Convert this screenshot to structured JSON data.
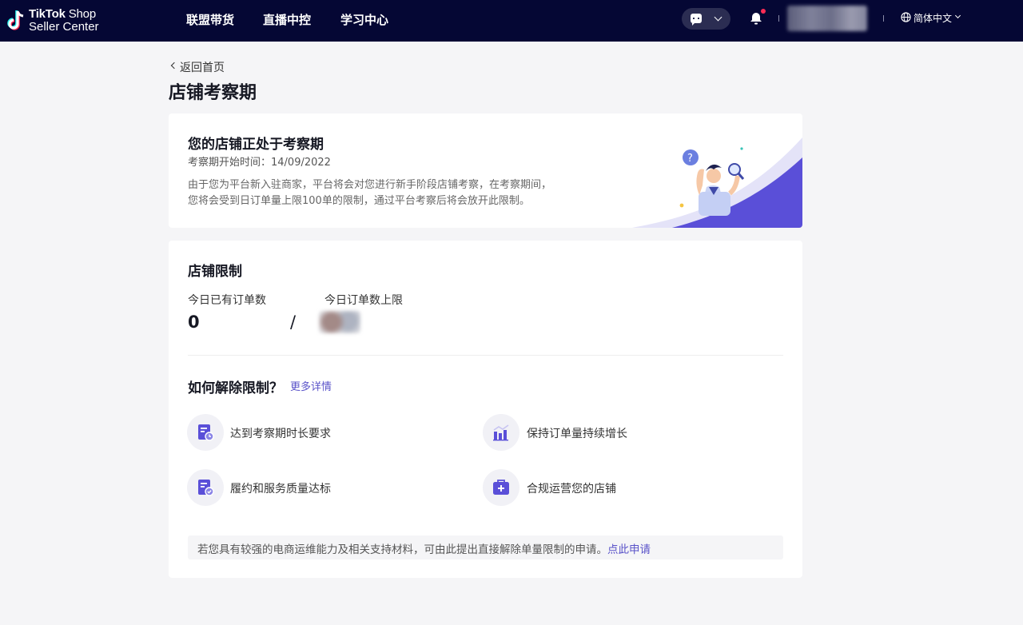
{
  "header": {
    "logo_line1_bold": "TikTok",
    "logo_line1_rest": " Shop",
    "logo_line2": "Seller Center",
    "nav": [
      "联盟带货",
      "直播中控",
      "学习中心"
    ],
    "language": "简体中文",
    "chat_icon": "chat-bubble-icon",
    "bell_icon": "bell-icon"
  },
  "page": {
    "back_label": "返回首页",
    "title": "店铺考察期"
  },
  "observation": {
    "title": "您的店铺正处于考察期",
    "start_label": "考察期开始时间：14/09/2022",
    "desc_line1": "由于您为平台新入驻商家，平台将会对您进行新手阶段店铺考察，在考察期间，",
    "desc_line2": "您将会受到日订单量上限100单的限制，通过平台考察后将会放开此限制。"
  },
  "limits": {
    "title": "店铺限制",
    "orders_today_label": "今日已有订单数",
    "orders_today_value": "0",
    "slash": "/",
    "daily_limit_label": "今日订单数上限"
  },
  "how": {
    "title": "如何解除限制？",
    "more_link": "更多详情",
    "requirements": [
      {
        "label": "达到考察期时长要求",
        "icon": "document-clock-icon"
      },
      {
        "label": "保持订单量持续增长",
        "icon": "bar-chart-icon"
      },
      {
        "label": "履约和服务质量达标",
        "icon": "document-check-icon"
      },
      {
        "label": "合规运营您的店铺",
        "icon": "shop-plus-icon"
      }
    ],
    "note": "若您具有较强的电商运维能力及相关支持材料，可由此提出直接解除单量限制的申请。",
    "note_link": "点此申请"
  },
  "colors": {
    "header_bg": "#050734",
    "accent": "#5a53c9",
    "notification_dot": "#fe2c55"
  }
}
